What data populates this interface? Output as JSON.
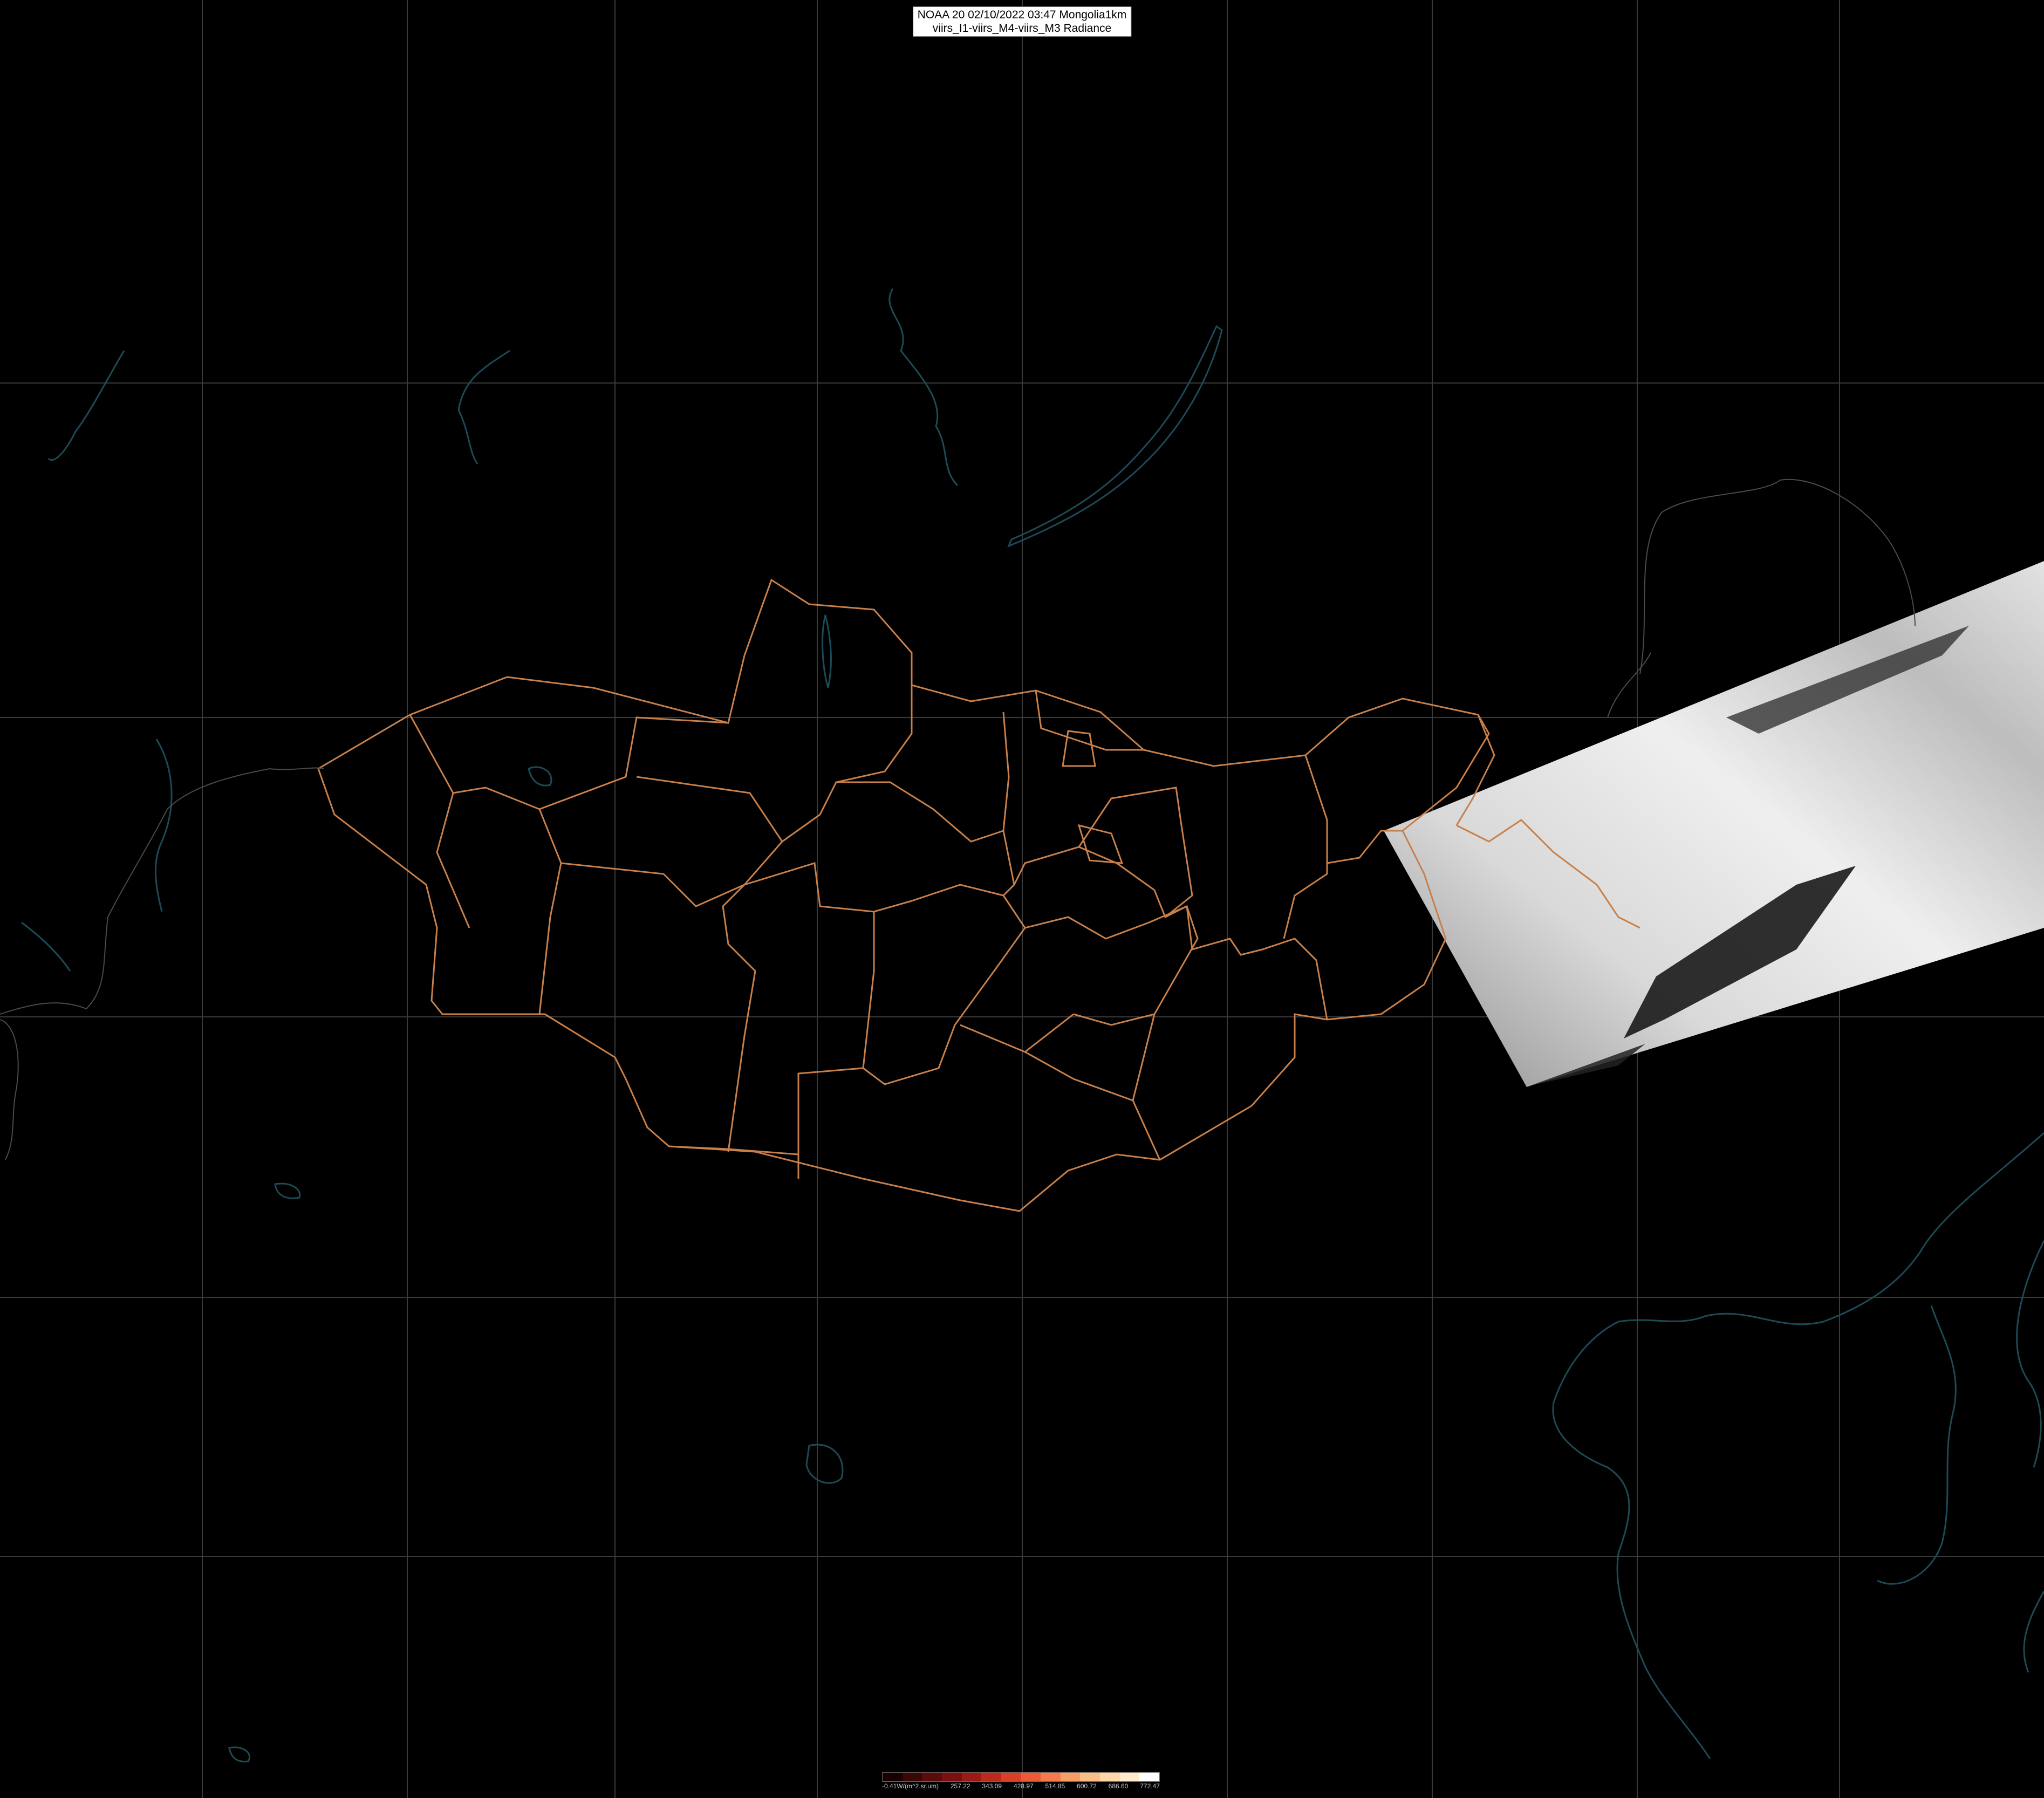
{
  "header": {
    "line1": "NOAA 20 02/10/2022 03:47 Mongolia1km",
    "line2": "viirs_I1-viirs_M4-viirs_M3 Radiance"
  },
  "colors": {
    "background": "#000000",
    "graticule": "#3a3a3a",
    "coastline": "#1d4a57",
    "admin_border": "#c8804a"
  },
  "colorbar": {
    "colors": [
      "#1a0000",
      "#3a0606",
      "#5a0b0b",
      "#7a1010",
      "#9c1a14",
      "#bd2a1c",
      "#dd3e26",
      "#ee5a35",
      "#f47c4c",
      "#f89d66",
      "#fbbd86",
      "#fdd7a8",
      "#feeccc",
      "#ffffff"
    ],
    "labels": [
      "-0.41W/(m^2.sr.um)",
      "257.22",
      "343.09",
      "428.97",
      "514.85",
      "600.72",
      "686.60",
      "772.47"
    ]
  }
}
